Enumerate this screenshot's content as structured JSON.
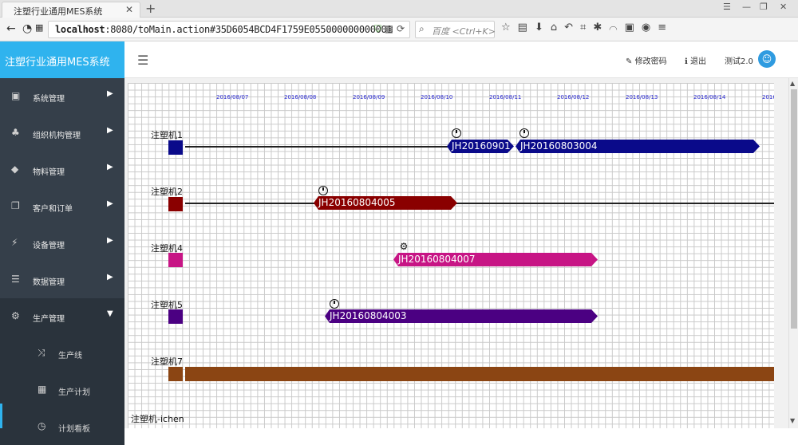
{
  "browser": {
    "tab_title": "注塑行业通用MES系统",
    "tab_close": "✕",
    "new_tab": "+",
    "url_host": "localhost",
    "url_rest": ":8080/toMain.action#35D6054BCD4F1759E055000000000001",
    "search_placeholder": "百度 <Ctrl+K>",
    "icons": [
      "back-icon",
      "forward-icon",
      "page-icon",
      "grid-icon",
      "shield-icon",
      "qr-icon",
      "reload-icon",
      "star-icon",
      "reader-icon",
      "download-icon",
      "home-icon",
      "undo-icon",
      "crop-icon",
      "extensions-icon",
      "rainbow-icon",
      "translate-icon",
      "chat-icon",
      "menu-icon"
    ]
  },
  "app": {
    "brand": "注塑行业通用MES系统",
    "change_password": "修改密码",
    "logout": "退出",
    "user": "测试2.0"
  },
  "sidebar": {
    "items": [
      {
        "label": "系统管理",
        "icon": "book-icon"
      },
      {
        "label": "组织机构管理",
        "icon": "sitemap-icon"
      },
      {
        "label": "物料管理",
        "icon": "cube-icon"
      },
      {
        "label": "客户和订单",
        "icon": "copy-icon"
      },
      {
        "label": "设备管理",
        "icon": "plug-icon"
      },
      {
        "label": "数据管理",
        "icon": "database-icon"
      },
      {
        "label": "生产管理",
        "icon": "cogs-icon"
      }
    ],
    "sub_items": [
      {
        "label": "生产线",
        "icon": "shuffle-icon"
      },
      {
        "label": "生产计划",
        "icon": "calendar-icon"
      },
      {
        "label": "计划看板",
        "icon": "clock-icon"
      }
    ]
  },
  "gantt": {
    "dates": [
      "2016/08/07",
      "2016/08/08",
      "2016/08/09",
      "2016/08/10",
      "2016/08/11",
      "2016/08/12",
      "2016/08/13",
      "2016/08/14",
      "2016"
    ],
    "machines": [
      {
        "name": "注塑机1",
        "color": "#0a0a8a"
      },
      {
        "name": "注塑机2",
        "color": "#8a0000"
      },
      {
        "name": "注塑机4",
        "color": "#c71585"
      },
      {
        "name": "注塑机5",
        "color": "#4b0082"
      },
      {
        "name": "注塑机7",
        "color": "#8b4513"
      },
      {
        "name": "注塑机-ichen",
        "color": ""
      }
    ],
    "tasks": [
      {
        "id": "JH20160901",
        "machine": "注塑机1",
        "color": "#0a0a8a",
        "status": "clock-icon"
      },
      {
        "id": "JH20160803004",
        "machine": "注塑机1",
        "color": "#0a0a8a",
        "status": "clock-icon"
      },
      {
        "id": "JH20160804005",
        "machine": "注塑机2",
        "color": "#8a0000",
        "status": "clock-icon"
      },
      {
        "id": "JH20160804007",
        "machine": "注塑机4",
        "color": "#c71585",
        "status": "cogs-icon"
      },
      {
        "id": "JH20160804003",
        "machine": "注塑机5",
        "color": "#4b0082",
        "status": "clock-icon"
      },
      {
        "id": "",
        "machine": "注塑机7",
        "color": "#8b4513",
        "status": ""
      }
    ]
  }
}
